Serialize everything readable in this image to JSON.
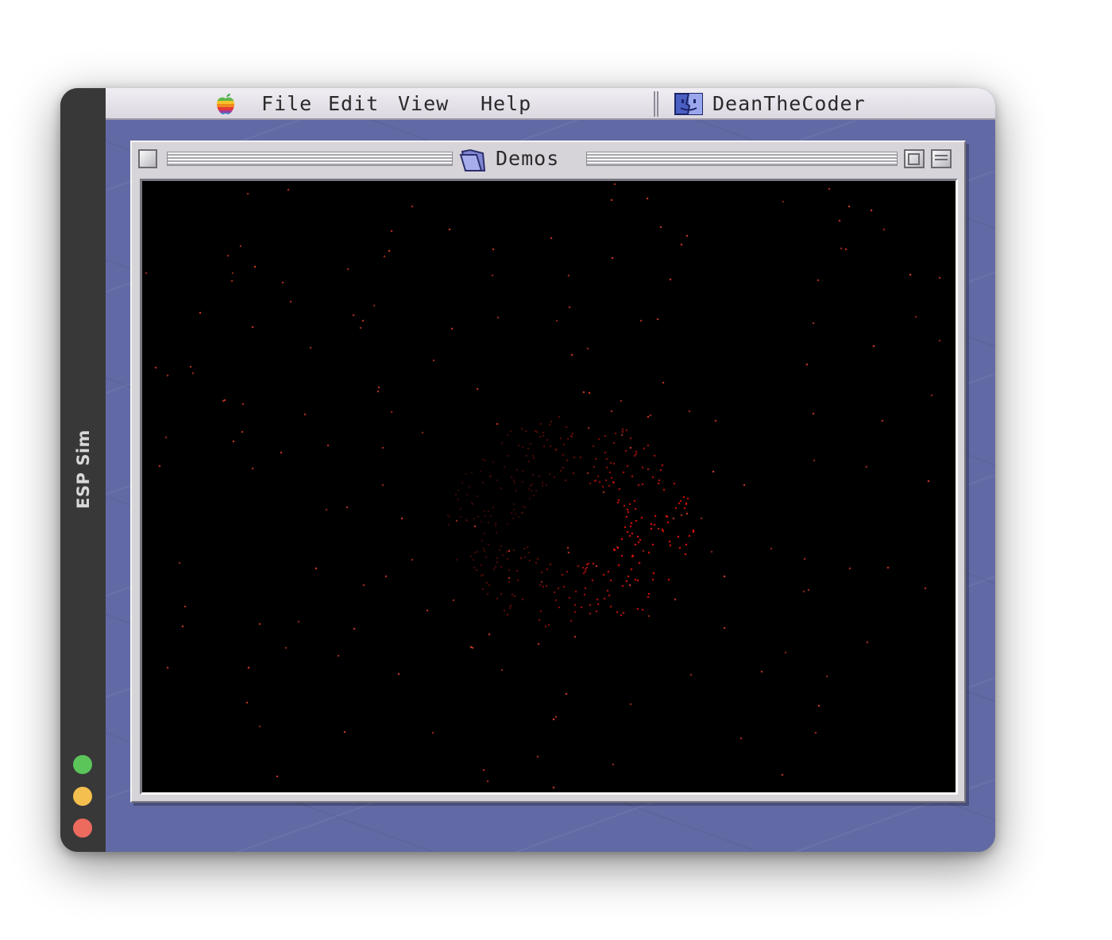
{
  "app": {
    "title": "ESP Sim"
  },
  "menubar": {
    "items": [
      {
        "label": "File"
      },
      {
        "label": "Edit"
      },
      {
        "label": "View"
      },
      {
        "label": "Help"
      }
    ],
    "app_name": "DeanTheCoder"
  },
  "window": {
    "title": "Demos"
  },
  "colors": {
    "desktop": "#626aa5",
    "particle": "#ff3b2f",
    "display_background": "#000000"
  },
  "icons": {
    "apple": "rainbow-apple-icon",
    "app": "finder-face-icon",
    "folder": "folder-icon"
  }
}
